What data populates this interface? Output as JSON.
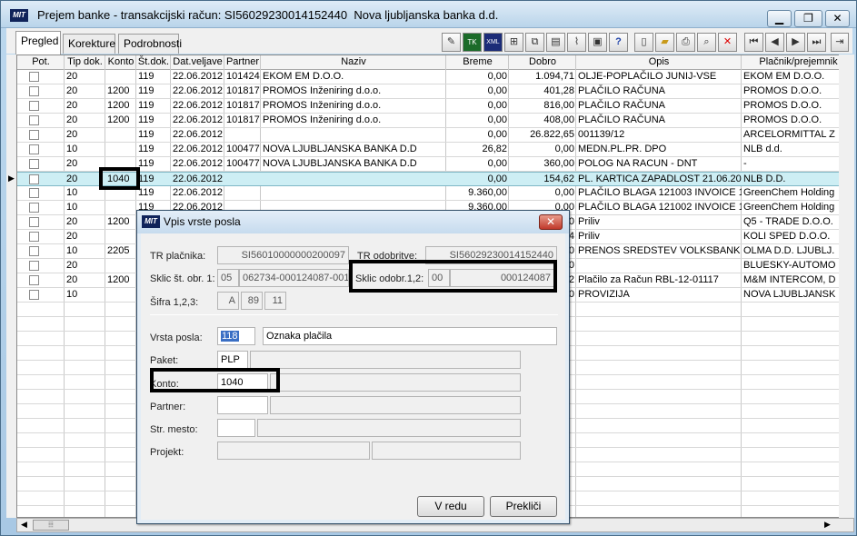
{
  "window": {
    "title": "Prejem banke - transakcijski račun: SI56029230014152440  Nova ljubljanska banka d.d.",
    "logo": "MIT"
  },
  "tabs": [
    {
      "label": "Pregled"
    },
    {
      "label": "Korekture"
    },
    {
      "label": "Podrobnosti"
    }
  ],
  "columns": [
    "Pot.",
    "Tip dok.",
    "Konto",
    "Št.dok.",
    "Dat.veljave",
    "Partner",
    "Naziv",
    "Breme",
    "Dobro",
    "Opis",
    "Plačnik/prejemnik"
  ],
  "rows": [
    {
      "tip": "20",
      "konto": "",
      "st": "119",
      "dat": "22.06.2012",
      "partner": "101424",
      "naziv": "EKOM EM D.O.O.",
      "breme": "0,00",
      "dobro": "1.094,71",
      "opis": "OLJE-POPLAČILO JUNIJ-VSE",
      "placnik": "EKOM EM D.O.O."
    },
    {
      "tip": "20",
      "konto": "1200",
      "st": "119",
      "dat": "22.06.2012",
      "partner": "101817",
      "naziv": "PROMOS Inženiring d.o.o.",
      "breme": "0,00",
      "dobro": "401,28",
      "opis": "PLAČILO RAČUNA",
      "placnik": "PROMOS D.O.O."
    },
    {
      "tip": "20",
      "konto": "1200",
      "st": "119",
      "dat": "22.06.2012",
      "partner": "101817",
      "naziv": "PROMOS Inženiring d.o.o.",
      "breme": "0,00",
      "dobro": "816,00",
      "opis": "PLAČILO RAČUNA",
      "placnik": "PROMOS D.O.O."
    },
    {
      "tip": "20",
      "konto": "1200",
      "st": "119",
      "dat": "22.06.2012",
      "partner": "101817",
      "naziv": "PROMOS Inženiring d.o.o.",
      "breme": "0,00",
      "dobro": "408,00",
      "opis": "PLAČILO RAČUNA",
      "placnik": "PROMOS D.O.O."
    },
    {
      "tip": "20",
      "konto": "",
      "st": "119",
      "dat": "22.06.2012",
      "partner": "",
      "naziv": "",
      "breme": "0,00",
      "dobro": "26.822,65",
      "opis": "001139/12",
      "placnik": "ARCELORMITTAL Z"
    },
    {
      "tip": "10",
      "konto": "",
      "st": "119",
      "dat": "22.06.2012",
      "partner": "100477",
      "naziv": "NOVA LJUBLJANSKA BANKA D.D",
      "breme": "26,82",
      "dobro": "0,00",
      "opis": "MEDN.PL.PR. DPO",
      "placnik": "NLB d.d."
    },
    {
      "tip": "20",
      "konto": "",
      "st": "119",
      "dat": "22.06.2012",
      "partner": "100477",
      "naziv": "NOVA LJUBLJANSKA BANKA D.D",
      "breme": "0,00",
      "dobro": "360,00",
      "opis": "POLOG NA RACUN - DNT",
      "placnik": "-"
    },
    {
      "tip": "20",
      "konto": "1040",
      "st": "119",
      "dat": "22.06.2012",
      "partner": "",
      "naziv": "",
      "breme": "0,00",
      "dobro": "154,62",
      "opis": "PL. KARTICA ZAPADLOST 21.06.20",
      "placnik": "NLB D.D.",
      "selected": true
    },
    {
      "tip": "10",
      "konto": "",
      "st": "119",
      "dat": "22.06.2012",
      "partner": "",
      "naziv": "",
      "breme": "9.360,00",
      "dobro": "0,00",
      "opis": "PLAČILO BLAGA 121003 INVOICE 1",
      "placnik": "GreenChem Holding"
    },
    {
      "tip": "10",
      "konto": "",
      "st": "119",
      "dat": "22.06.2012",
      "partner": "",
      "naziv": "",
      "breme": "9.360,00",
      "dobro": "0,00",
      "opis": "PLAČILO BLAGA 121002 INVOICE 1",
      "placnik": "GreenChem Holding"
    },
    {
      "tip": "20",
      "konto": "1200",
      "st": "",
      "dat": "",
      "partner": "",
      "naziv": "",
      "breme": "",
      "dobro": "0",
      "opis": "Priliv",
      "placnik": "Q5 - TRADE D.O.O."
    },
    {
      "tip": "20",
      "konto": "",
      "st": "",
      "dat": "",
      "partner": "",
      "naziv": "",
      "breme": "",
      "dobro": "4",
      "opis": "Priliv",
      "placnik": "KOLI SPED D.O.O."
    },
    {
      "tip": "10",
      "konto": "2205",
      "st": "",
      "dat": "",
      "partner": "",
      "naziv": "",
      "breme": "",
      "dobro": "0",
      "opis": "PRENOS SREDSTEV VOLKSBANK",
      "placnik": "OLMA  D.D. LJUBLJ."
    },
    {
      "tip": "20",
      "konto": "",
      "st": "",
      "dat": "",
      "partner": "",
      "naziv": "",
      "breme": "",
      "dobro": "0",
      "opis": "",
      "placnik": "BLUESKY-AUTOMO"
    },
    {
      "tip": "20",
      "konto": "1200",
      "st": "",
      "dat": "",
      "partner": "",
      "naziv": "",
      "breme": "",
      "dobro": "2",
      "opis": "Plačilo za Račun RBL-12-01117",
      "placnik": "M&M INTERCOM, D"
    },
    {
      "tip": "10",
      "konto": "",
      "st": "",
      "dat": "",
      "partner": "",
      "naziv": "",
      "breme": "",
      "dobro": "0",
      "opis": "PROVIZIJA",
      "placnik": "NOVA LJUBLJANSK"
    }
  ],
  "dialog": {
    "title": "Vpis vrste posla",
    "tr_placnika_label": "TR plačnika:",
    "tr_placnika": "SI56010000000200097",
    "tr_odobritve_label": "TR odobritve:",
    "tr_odobritve": "SI56029230014152440",
    "sklic_obr1_label": "Sklic št. obr. 1:",
    "sklic_obr1_a": "05",
    "sklic_obr1_b": "062734-000124087-001",
    "sklic_odobr_label": "Sklic odobr.1,2:",
    "sklic_odobr_a": "00",
    "sklic_odobr_b": "000124087",
    "sifra_label": "Šifra 1,2,3:",
    "sifra_1": "A",
    "sifra_2": "89",
    "sifra_3": "11",
    "vrsta_posla_label": "Vrsta posla:",
    "vrsta_posla": "118",
    "vrsta_posla_desc": "Oznaka plačila",
    "paket_label": "Paket:",
    "paket": "PLP",
    "konto_label": "Konto:",
    "konto": "1040",
    "partner_label": "Partner:",
    "str_mesto_label": "Str. mesto:",
    "projekt_label": "Projekt:",
    "ok_label": "V redu",
    "cancel_label": "Prekliči"
  }
}
